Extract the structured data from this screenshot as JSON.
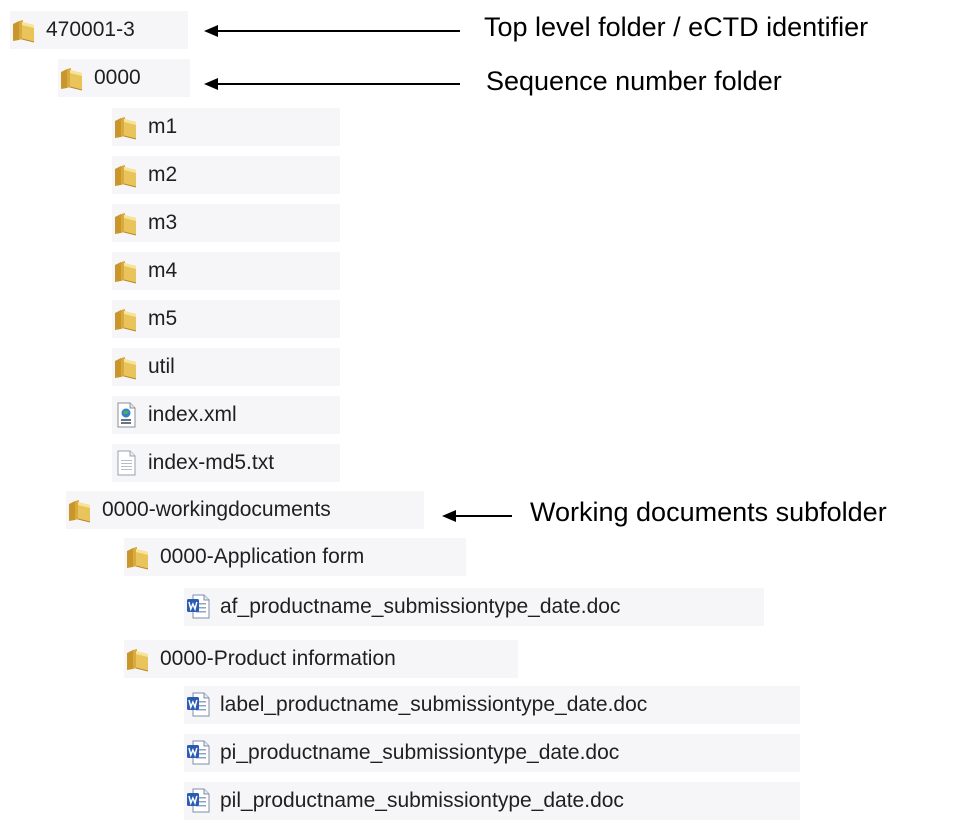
{
  "tree": {
    "root": {
      "label": "470001-3",
      "icon": "folder-icon"
    },
    "sequence": {
      "label": "0000",
      "icon": "folder-icon"
    },
    "m1": {
      "label": "m1",
      "icon": "folder-icon"
    },
    "m2": {
      "label": "m2",
      "icon": "folder-icon"
    },
    "m3": {
      "label": "m3",
      "icon": "folder-icon"
    },
    "m4": {
      "label": "m4",
      "icon": "folder-icon"
    },
    "m5": {
      "label": "m5",
      "icon": "folder-icon"
    },
    "util": {
      "label": "util",
      "icon": "folder-icon"
    },
    "index_xml": {
      "label": "index.xml",
      "icon": "xml-file-icon"
    },
    "index_md5": {
      "label": "index-md5.txt",
      "icon": "text-file-icon"
    },
    "working": {
      "label": "0000-workingdocuments",
      "icon": "folder-icon"
    },
    "app_form": {
      "label": "0000-Application form",
      "icon": "folder-icon"
    },
    "af_doc": {
      "label": "af_productname_submissiontype_date.doc",
      "icon": "word-doc-icon"
    },
    "prod_info": {
      "label": "0000-Product information",
      "icon": "folder-icon"
    },
    "label_doc": {
      "label": "label_productname_submissiontype_date.doc",
      "icon": "word-doc-icon"
    },
    "pi_doc": {
      "label": "pi_productname_submissiontype_date.doc",
      "icon": "word-doc-icon"
    },
    "pil_doc": {
      "label": "pil_productname_submissiontype_date.doc",
      "icon": "word-doc-icon"
    }
  },
  "annotations": {
    "top_level": "Top level folder / eCTD identifier",
    "sequence": "Sequence number folder",
    "working": "Working documents subfolder"
  },
  "colors": {
    "folder_body": "#e8c45a",
    "folder_back": "#c9962c",
    "folder_light": "#f7e39a",
    "word_blue": "#2b5cb5",
    "row_background": "#f6f6f8"
  }
}
